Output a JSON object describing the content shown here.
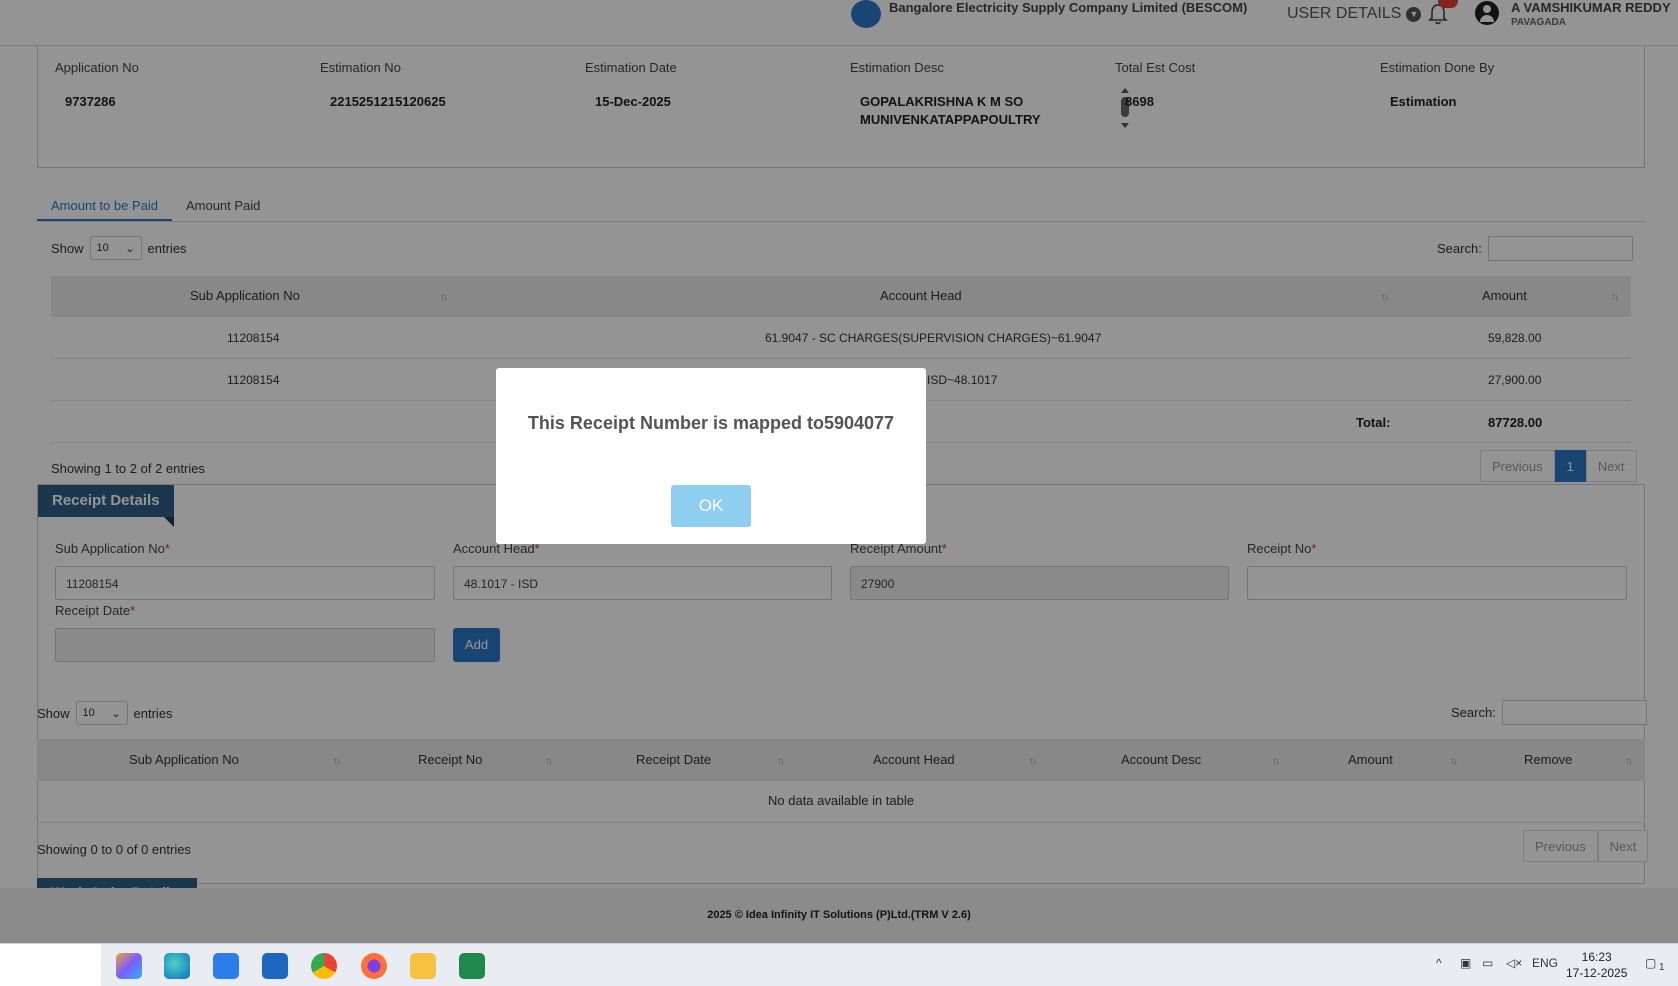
{
  "header": {
    "brand": "Bangalore Electricity Supply Company Limited (BESCOM)",
    "user_details_label": "USER DETAILS",
    "user_name": "A VAMSHIKUMAR REDDY",
    "user_location": "PAVAGADA"
  },
  "estimation": {
    "columns": [
      {
        "label": "Application No",
        "value": "9737286"
      },
      {
        "label": "Estimation No",
        "value": "2215251215120625"
      },
      {
        "label": "Estimation Date",
        "value": "15-Dec-2025"
      },
      {
        "label": "Estimation Desc",
        "value": "GOPALAKRISHNA K M SO MUNIVENKATAPPAPOULTRY FARM AT BYAPPANAHALLI VILLAGE"
      },
      {
        "label": "Total Est Cost",
        "value": "8698"
      },
      {
        "label": "Estimation Done By",
        "value": "Estimation"
      }
    ]
  },
  "tabs": [
    {
      "label": "Amount to be Paid",
      "active": true
    },
    {
      "label": "Amount Paid",
      "active": false
    }
  ],
  "amount_table": {
    "show_label": "Show",
    "entries_value": "10",
    "entries_label": "entries",
    "search_label": "Search:",
    "headers": [
      "Sub Application No",
      "Account Head",
      "Amount"
    ],
    "rows": [
      {
        "sub_app": "11208154",
        "account_head": "61.9047 - SC CHARGES(SUPERVISION CHARGES)~61.9047",
        "amount": "59,828.00"
      },
      {
        "sub_app": "11208154",
        "account_head": "48.1017 - ISD~48.1017",
        "amount": "27,900.00"
      }
    ],
    "total_label": "Total:",
    "total_value": "87728.00",
    "info": "Showing 1 to 2 of 2 entries",
    "prev_label": "Previous",
    "page": "1",
    "next_label": "Next"
  },
  "receipt": {
    "title": "Receipt Details",
    "sub_app_label": "Sub Application No",
    "sub_app_value": "11208154",
    "account_head_label": "Account Head",
    "account_head_value": "48.1017 - ISD",
    "receipt_amount_label": "Receipt Amount",
    "receipt_amount_value": "27900",
    "receipt_no_label": "Receipt No",
    "receipt_no_value": "",
    "receipt_date_label": "Receipt Date",
    "receipt_date_value": "",
    "required_mark": "*",
    "add_label": "Add"
  },
  "receipt_table": {
    "show_label": "Show",
    "entries_value": "10",
    "entries_label": "entries",
    "search_label": "Search:",
    "headers": [
      "Sub Application No",
      "Receipt No",
      "Receipt Date",
      "Account Head",
      "Account Desc",
      "Amount",
      "Remove"
    ],
    "empty_text": "No data available in table",
    "info": "Showing 0 to 0 of 0 entries",
    "prev_label": "Previous",
    "next_label": "Next"
  },
  "work_order": {
    "title": "Work Order Details"
  },
  "footer": {
    "text": "2025 © Idea Infinity IT Solutions (P)Ltd.(TRM V 2.6)"
  },
  "modal": {
    "message": "This Receipt Number is mapped to5904077",
    "ok_label": "OK"
  },
  "taskbar": {
    "language": "ENG",
    "time": "16:23",
    "date": "17-12-2025",
    "notification_count": "1",
    "apps": [
      "copilot-icon",
      "edge-icon",
      "store-icon",
      "outlook-icon",
      "chrome-icon",
      "firefox-icon",
      "file-explorer-icon",
      "excel-icon"
    ]
  },
  "colors": {
    "primary": "#2b78c5",
    "panel_header": "#2f5f8a",
    "ok_button": "#8ecff0",
    "required": "#d32f2f"
  }
}
